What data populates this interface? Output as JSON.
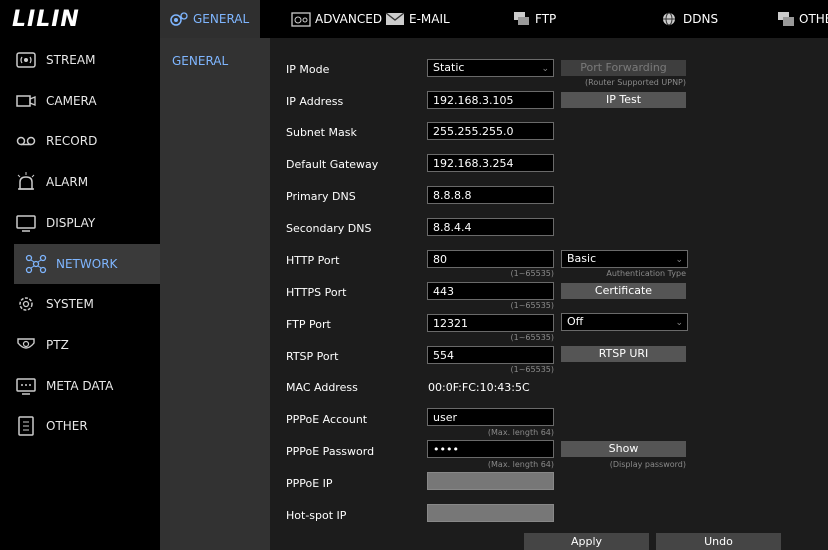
{
  "logo": "LILIN",
  "sidebar": {
    "items": [
      {
        "label": "STREAM",
        "icon": "stream-icon"
      },
      {
        "label": "CAMERA",
        "icon": "camera-icon"
      },
      {
        "label": "RECORD",
        "icon": "record-icon"
      },
      {
        "label": "ALARM",
        "icon": "alarm-icon"
      },
      {
        "label": "DISPLAY",
        "icon": "display-icon"
      },
      {
        "label": "NETWORK",
        "icon": "network-icon"
      },
      {
        "label": "SYSTEM",
        "icon": "system-icon"
      },
      {
        "label": "PTZ",
        "icon": "ptz-icon"
      },
      {
        "label": "META DATA",
        "icon": "meta-data-icon"
      },
      {
        "label": "OTHER",
        "icon": "other-icon"
      }
    ],
    "active": "NETWORK"
  },
  "tabs": [
    {
      "label": "GENERAL",
      "icon": "general-icon"
    },
    {
      "label": "ADVANCED",
      "icon": "advanced-icon"
    },
    {
      "label": "E-MAIL",
      "icon": "email-icon"
    },
    {
      "label": "FTP",
      "icon": "ftp-icon"
    },
    {
      "label": "DDNS",
      "icon": "ddns-icon"
    },
    {
      "label": "OTHE",
      "icon": "other-tab-icon"
    }
  ],
  "subnav": {
    "items": [
      "GENERAL"
    ]
  },
  "form": {
    "ip_mode": {
      "label": "IP Mode",
      "value": "Static"
    },
    "port_forwarding": {
      "label": "Port Forwarding",
      "hint": "(Router Supported UPNP)"
    },
    "ip_address": {
      "label": "IP Address",
      "value": "192.168.3.105"
    },
    "ip_test": {
      "label": "IP Test"
    },
    "subnet_mask": {
      "label": "Subnet Mask",
      "value": "255.255.255.0"
    },
    "default_gateway": {
      "label": "Default Gateway",
      "value": "192.168.3.254"
    },
    "primary_dns": {
      "label": "Primary DNS",
      "value": "8.8.8.8"
    },
    "secondary_dns": {
      "label": "Secondary DNS",
      "value": "8.8.4.4"
    },
    "http_port": {
      "label": "HTTP Port",
      "value": "80",
      "hint": "(1~65535)"
    },
    "auth_type": {
      "value": "Basic",
      "hint": "Authentication Type"
    },
    "https_port": {
      "label": "HTTPS Port",
      "value": "443",
      "hint": "(1~65535)"
    },
    "certificate": {
      "label": "Certificate"
    },
    "ftp_port": {
      "label": "FTP Port",
      "value": "12321",
      "hint": "(1~65535)"
    },
    "ftp_state": {
      "value": "Off"
    },
    "rtsp_port": {
      "label": "RTSP Port",
      "value": "554",
      "hint": "(1~65535)"
    },
    "rtsp_uri": {
      "label": "RTSP URI"
    },
    "mac_address": {
      "label": "MAC Address",
      "value": "00:0F:FC:10:43:5C"
    },
    "pppoe_account": {
      "label": "PPPoE Account",
      "value": "user",
      "hint": "(Max. length 64)"
    },
    "pppoe_password": {
      "label": "PPPoE Password",
      "value": "••••",
      "hint": "(Max. length 64)"
    },
    "show": {
      "label": "Show",
      "hint": "(Display password)"
    },
    "pppoe_ip": {
      "label": "PPPoE IP",
      "value": ""
    },
    "hotspot_ip": {
      "label": "Hot-spot IP",
      "value": ""
    }
  },
  "actions": {
    "apply": "Apply",
    "undo": "Undo"
  },
  "colors": {
    "accent": "#7fb6ff",
    "panel": "#1c1c1c",
    "subnav": "#323232",
    "active_nav": "#3a3a3a"
  }
}
